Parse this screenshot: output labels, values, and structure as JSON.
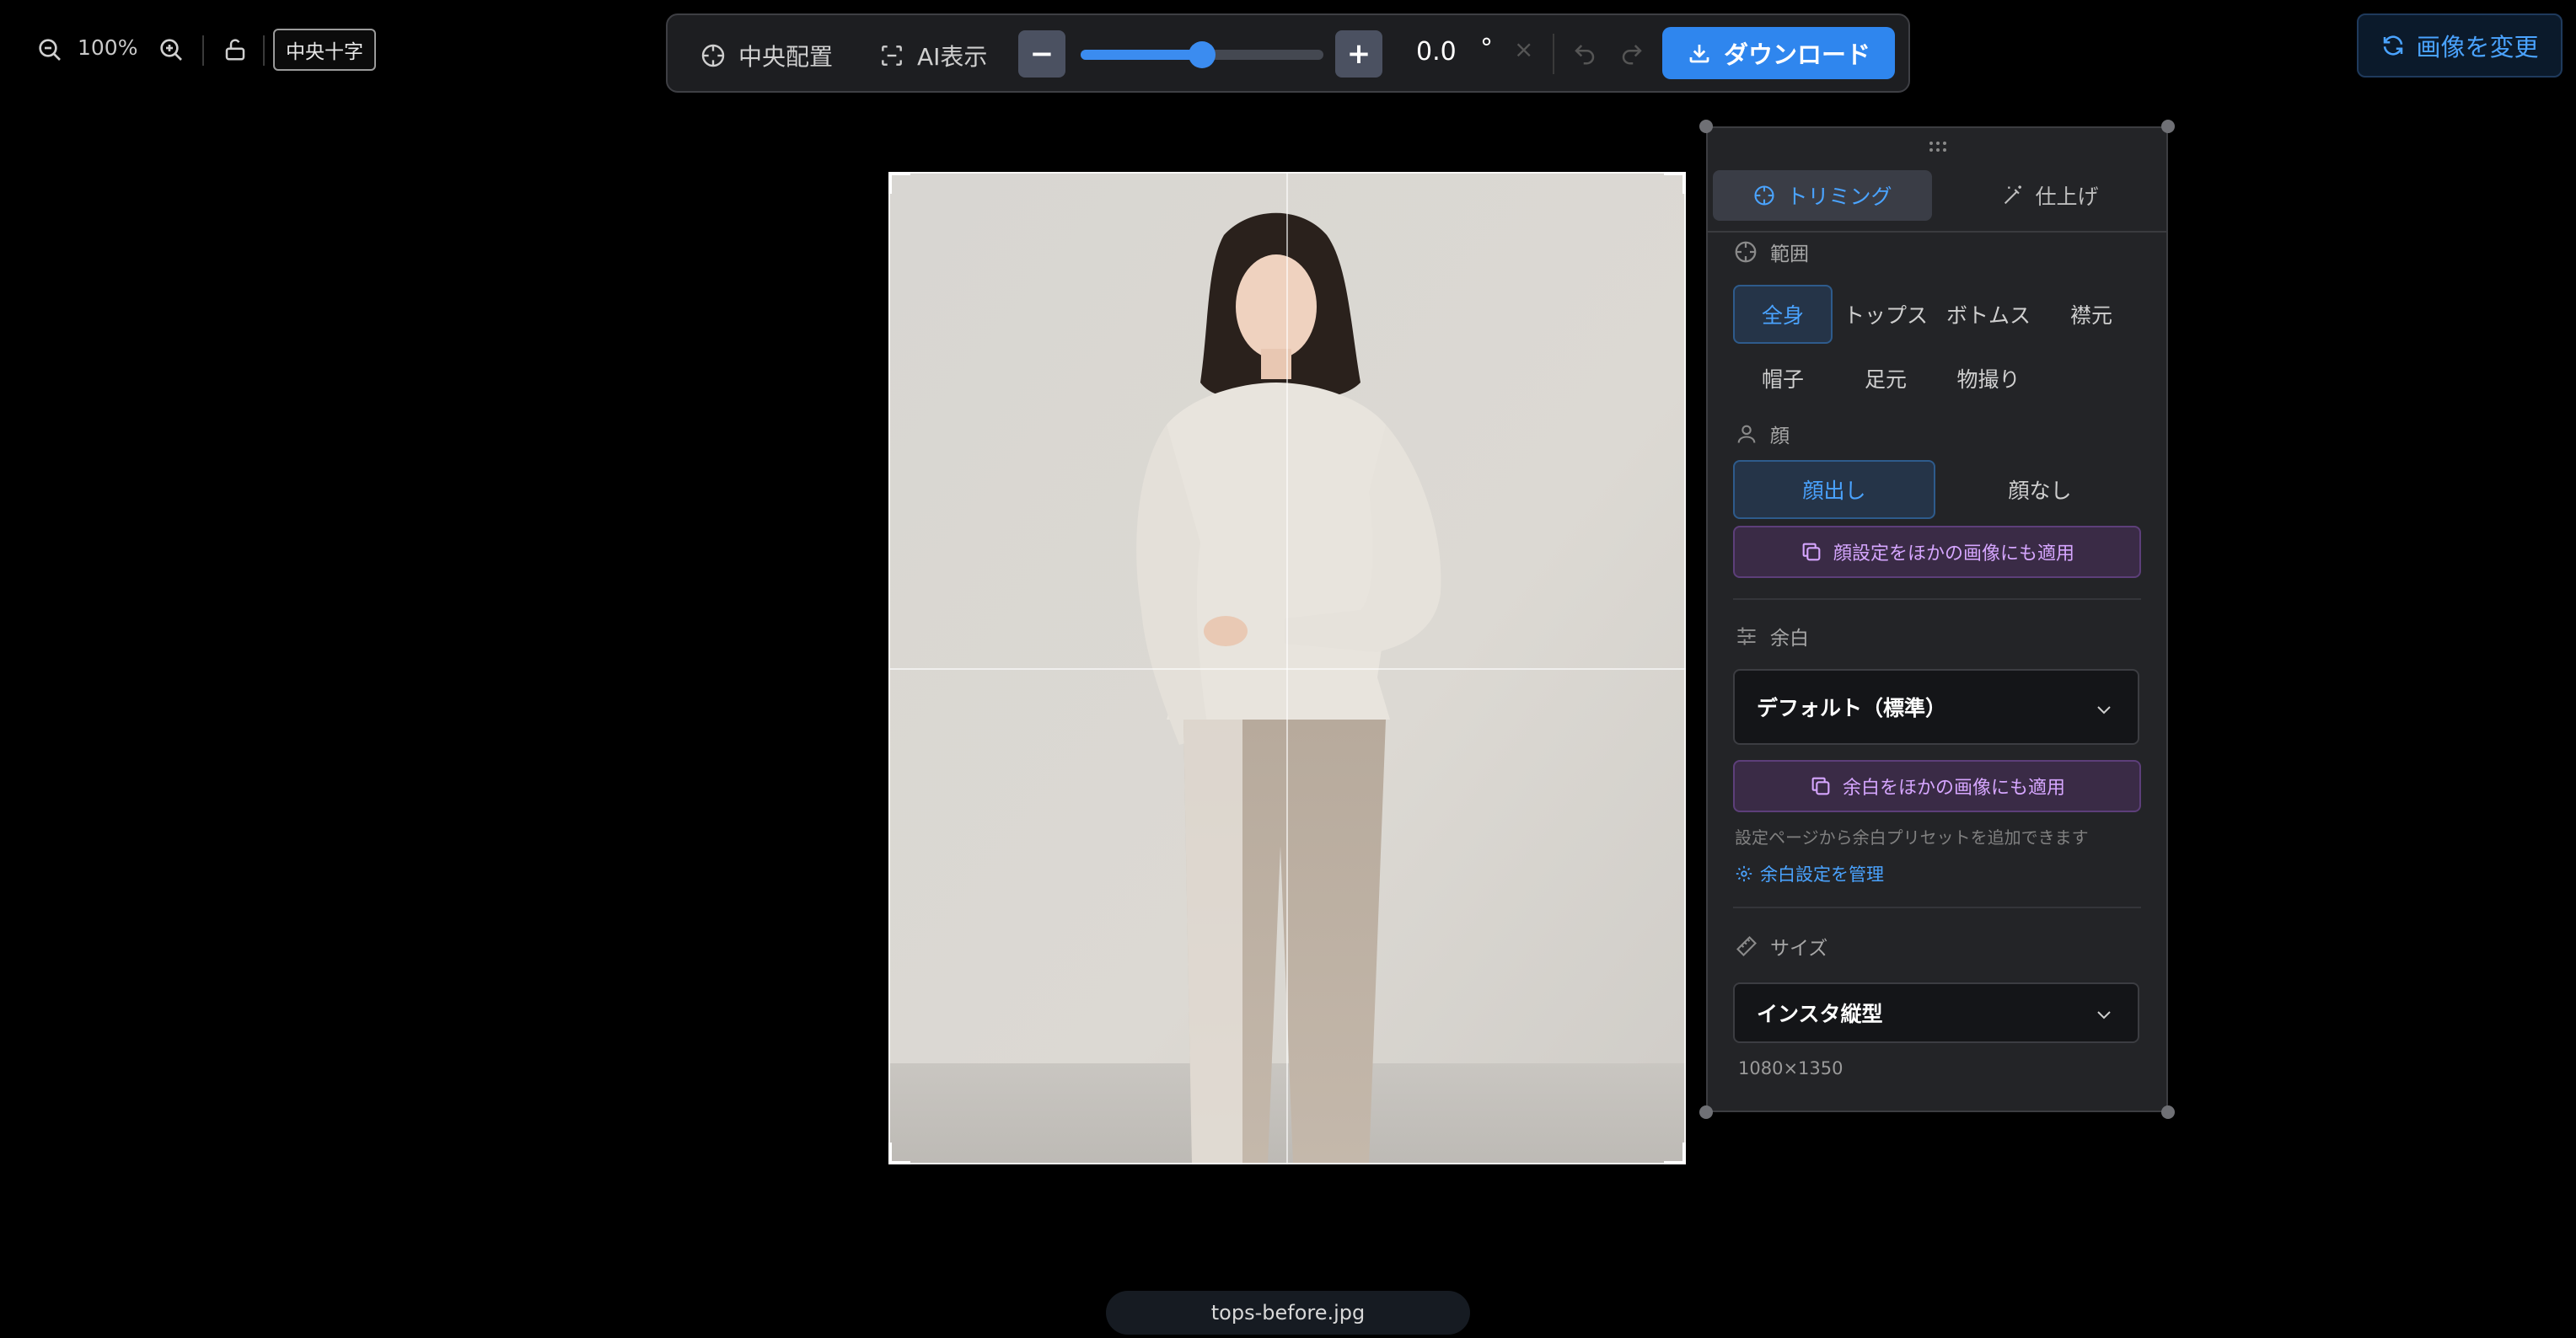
{
  "view": {
    "zoom_level": "100%",
    "crosshair_label": "中央十字"
  },
  "toolbar": {
    "center_label": "中央配置",
    "ai_label": "AI表示",
    "minus_label": "−",
    "plus_label": "+",
    "rotation_value": "0.0",
    "rotation_unit": "°",
    "rotation_level_fraction": 0.5,
    "clear_label": "×",
    "download_label": "ダウンロード"
  },
  "change_image_label": "画像を変更",
  "panel": {
    "tabs": [
      {
        "label": "トリミング",
        "active": true
      },
      {
        "label": "仕上げ",
        "active": false
      }
    ],
    "range": {
      "title": "範囲",
      "options": [
        "全身",
        "トップス",
        "ボトムス",
        "襟元",
        "帽子",
        "足元",
        "物撮り"
      ],
      "selected": "全身"
    },
    "face": {
      "title": "顔",
      "options": [
        "顔出し",
        "顔なし"
      ],
      "selected": "顔出し",
      "apply_label": "顔設定をほかの画像にも適用"
    },
    "margin": {
      "title": "余白",
      "value": "デフォルト（標準）",
      "apply_label": "余白をほかの画像にも適用",
      "hint": "設定ページから余白プリセットを追加できます",
      "manage_link": "余白設定を管理"
    },
    "size": {
      "title": "サイズ",
      "value": "インスタ縦型",
      "dimensions": "1080×1350"
    }
  },
  "file_name": "tops-before.jpg",
  "colors": {
    "accent": "#2f86ee",
    "link": "#4aa3ff",
    "apply_purple": "#d6a6ff"
  }
}
